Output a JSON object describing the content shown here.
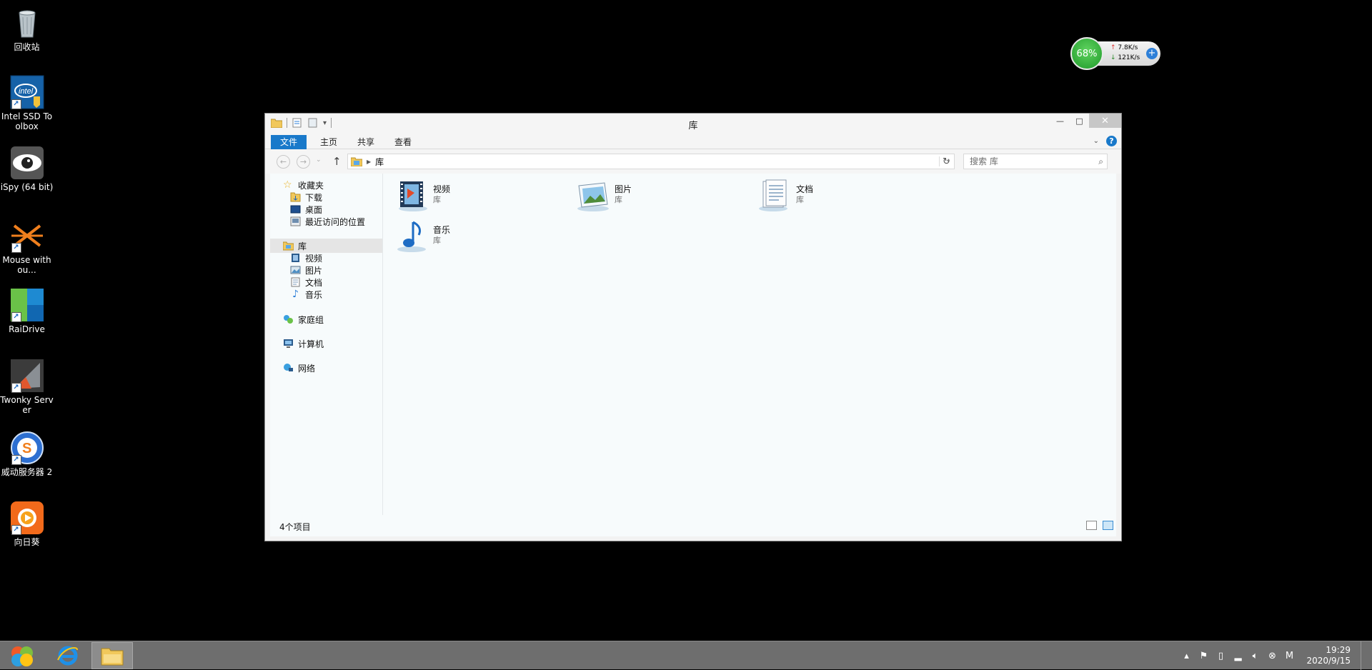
{
  "desktop_icons": [
    {
      "label": "回收站",
      "icon": "recycle-bin-icon"
    },
    {
      "label": "Intel SSD Toolbox",
      "icon": "intel-ssd-toolbox-icon"
    },
    {
      "label": "iSpy (64 bit)",
      "icon": "ispy-icon"
    },
    {
      "label": "Mouse withou...",
      "icon": "mouse-without-borders-icon"
    },
    {
      "label": "RaiDrive",
      "icon": "raidrive-icon"
    },
    {
      "label": "Twonky Server",
      "icon": "twonky-server-icon"
    },
    {
      "label": "威动服务器 2",
      "icon": "weidong-server-icon"
    },
    {
      "label": "向日葵",
      "icon": "sunflower-remote-icon"
    }
  ],
  "net_widget": {
    "percent": "68%",
    "upload": "7.8K/s",
    "download": "121K/s",
    "plus": "+"
  },
  "window": {
    "title": "库",
    "min": "—",
    "max": "□",
    "close": "✕"
  },
  "ribbon": {
    "tabs": [
      "文件",
      "主页",
      "共享",
      "查看"
    ],
    "help": "?",
    "expand": "⌄"
  },
  "address": {
    "path": "库",
    "search_placeholder": "搜索 库",
    "back": "←",
    "forward": "→",
    "recent": "⌄",
    "up": "↑",
    "refresh": "↻",
    "dropdown": "⌄",
    "crumb_arrow": "▶"
  },
  "nav": {
    "favorites": {
      "label": "收藏夹",
      "items": [
        "下载",
        "桌面",
        "最近访问的位置"
      ]
    },
    "libraries": {
      "label": "库",
      "items": [
        "视频",
        "图片",
        "文档",
        "音乐"
      ]
    },
    "homegroup": "家庭组",
    "computer": "计算机",
    "network": "网络"
  },
  "libraries": [
    {
      "name": "视频",
      "type": "库",
      "icon": "video-library-icon"
    },
    {
      "name": "图片",
      "type": "库",
      "icon": "pictures-library-icon"
    },
    {
      "name": "文档",
      "type": "库",
      "icon": "documents-library-icon"
    },
    {
      "name": "音乐",
      "type": "库",
      "icon": "music-library-icon"
    }
  ],
  "status": {
    "count": "4个项目"
  },
  "taskbar": {
    "clock_time": "19:29",
    "clock_date": "2020/9/15",
    "tray_ime": "M"
  }
}
